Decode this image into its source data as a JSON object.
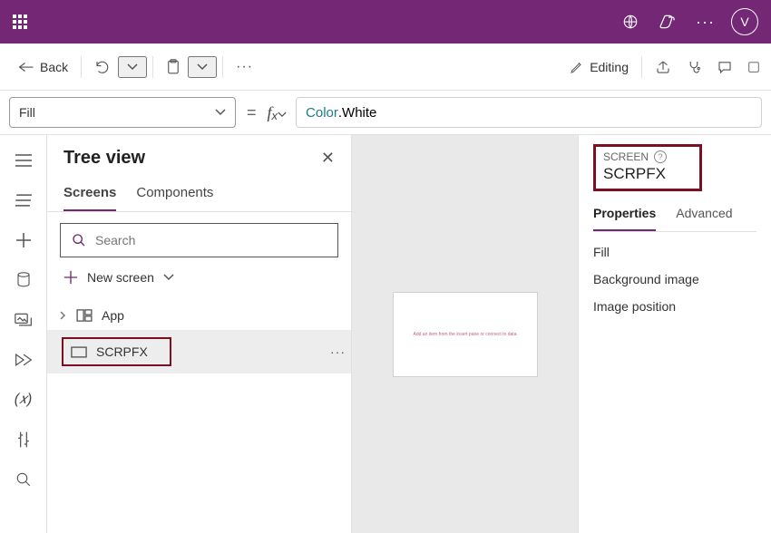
{
  "header": {
    "avatar_initial": "V"
  },
  "cmdbar": {
    "back": "Back",
    "editing": "Editing"
  },
  "formula": {
    "property": "Fill",
    "kw": "Color",
    "rest": ".White"
  },
  "tree": {
    "title": "Tree view",
    "tabs": {
      "screens": "Screens",
      "components": "Components"
    },
    "search_placeholder": "Search",
    "new_screen": "New screen",
    "items": [
      {
        "label": "App"
      },
      {
        "label": "SCRPFX"
      }
    ]
  },
  "props": {
    "type": "SCREEN",
    "name": "SCRPFX",
    "tabs": {
      "properties": "Properties",
      "advanced": "Advanced"
    },
    "rows": {
      "fill": "Fill",
      "bg": "Background image",
      "imgpos": "Image position"
    }
  },
  "canvas": {
    "tiny_text": "Add an item from the insert pane or connect to data"
  }
}
